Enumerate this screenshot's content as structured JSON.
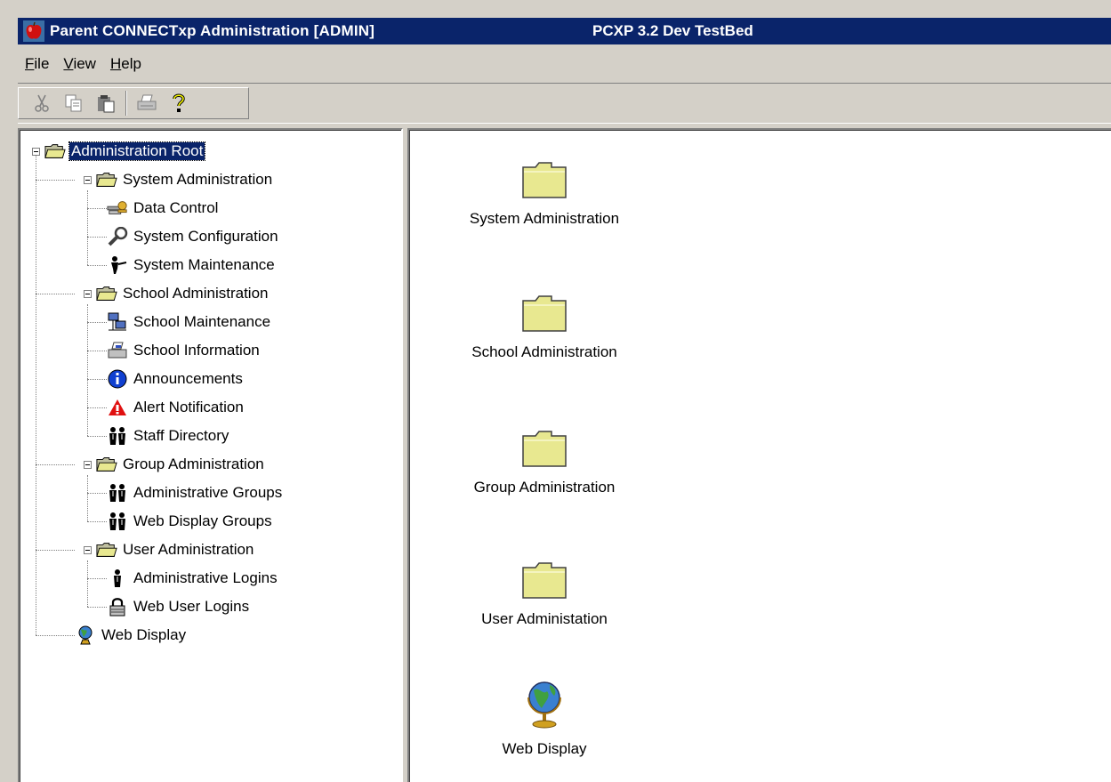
{
  "window": {
    "title": "Parent CONNECTxp Administration [ADMIN]",
    "environment": "PCXP 3.2 Dev TestBed",
    "title_bar_color": "#0a246a"
  },
  "menu": [
    {
      "label_first": "F",
      "label_rest": "ile"
    },
    {
      "label_first": "V",
      "label_rest": "iew"
    },
    {
      "label_first": "H",
      "label_rest": "elp"
    }
  ],
  "toolbar": {
    "buttons": [
      "cut-icon",
      "copy-icon",
      "paste-icon",
      "print-icon",
      "help-icon"
    ]
  },
  "tree": {
    "root": {
      "label": "Administration Root",
      "icon": "folder-open-icon",
      "selected": true
    },
    "groups": [
      {
        "label": "System Administration",
        "icon": "folder-open-icon",
        "children": [
          {
            "label": "Data Control",
            "icon": "data-control-icon"
          },
          {
            "label": "System Configuration",
            "icon": "wrench-icon"
          },
          {
            "label": "System Maintenance",
            "icon": "maintenance-person-icon"
          }
        ]
      },
      {
        "label": "School Administration",
        "icon": "folder-open-icon",
        "children": [
          {
            "label": "School Maintenance",
            "icon": "network-computers-icon"
          },
          {
            "label": "School Information",
            "icon": "printer-info-icon"
          },
          {
            "label": "Announcements",
            "icon": "info-icon"
          },
          {
            "label": "Alert Notification",
            "icon": "warning-icon"
          },
          {
            "label": "Staff Directory",
            "icon": "people-icon"
          }
        ]
      },
      {
        "label": "Group Administration",
        "icon": "folder-open-icon",
        "children": [
          {
            "label": "Administrative Groups",
            "icon": "people-icon"
          },
          {
            "label": "Web Display Groups",
            "icon": "people-icon"
          }
        ]
      },
      {
        "label": "User Administration",
        "icon": "folder-open-icon",
        "children": [
          {
            "label": "Administrative Logins",
            "icon": "person-icon"
          },
          {
            "label": "Web User Logins",
            "icon": "lock-icon"
          }
        ]
      }
    ],
    "web_display": {
      "label": "Web Display",
      "icon": "globe-icon"
    }
  },
  "list": {
    "items": [
      {
        "label": "System Administration",
        "icon": "folder-icon"
      },
      {
        "label": "School Administration",
        "icon": "folder-icon"
      },
      {
        "label": "Group Administration",
        "icon": "folder-icon"
      },
      {
        "label": "User Administation",
        "icon": "folder-icon"
      },
      {
        "label": "Web Display",
        "icon": "globe-icon"
      }
    ]
  }
}
